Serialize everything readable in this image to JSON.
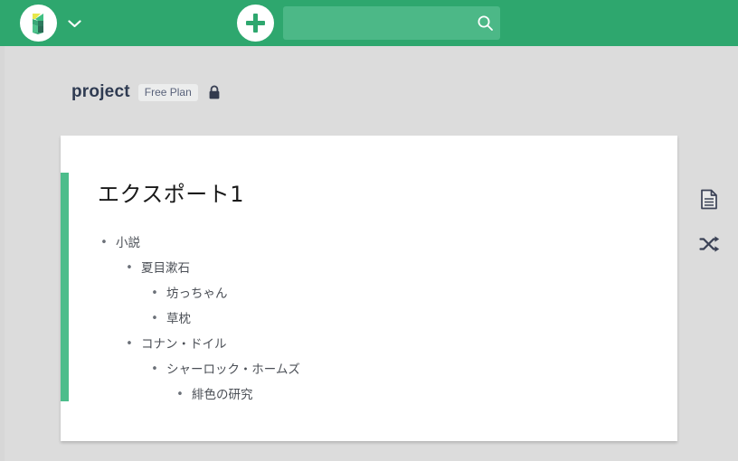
{
  "topbar": {
    "logo_name": "app-logo",
    "logo_caret_name": "workspace-chevron",
    "add_button_label": "+",
    "search": {
      "value": "",
      "placeholder": ""
    }
  },
  "project": {
    "name": "project",
    "plan_badge": "Free Plan",
    "lock_label": "private"
  },
  "document": {
    "title": "エクスポート1",
    "outline": [
      {
        "depth": 0,
        "bullet": "•",
        "text": "小説"
      },
      {
        "depth": 1,
        "bullet": "•",
        "text": "夏目漱石"
      },
      {
        "depth": 2,
        "bullet": "•",
        "text": "坊っちゃん"
      },
      {
        "depth": 2,
        "bullet": "•",
        "text": "草枕"
      },
      {
        "depth": 1,
        "bullet": "•",
        "text": "コナン・ドイル"
      },
      {
        "depth": 2,
        "bullet": "•",
        "text": "シャーロック・ホームズ"
      },
      {
        "depth": 3,
        "bullet": "•",
        "text": "緋色の研究"
      }
    ]
  },
  "right_rail": {
    "items": [
      {
        "icon": "document-icon"
      },
      {
        "icon": "shuffle-icon"
      }
    ]
  },
  "colors": {
    "header_green": "#2ea76e",
    "search_green": "#4cb887",
    "accent_green": "#4cbd8b",
    "page_bg": "#dcdcdc",
    "card_bg": "#ffffff",
    "title_navy": "#2f3b52",
    "text_gray": "#4b4f56"
  }
}
